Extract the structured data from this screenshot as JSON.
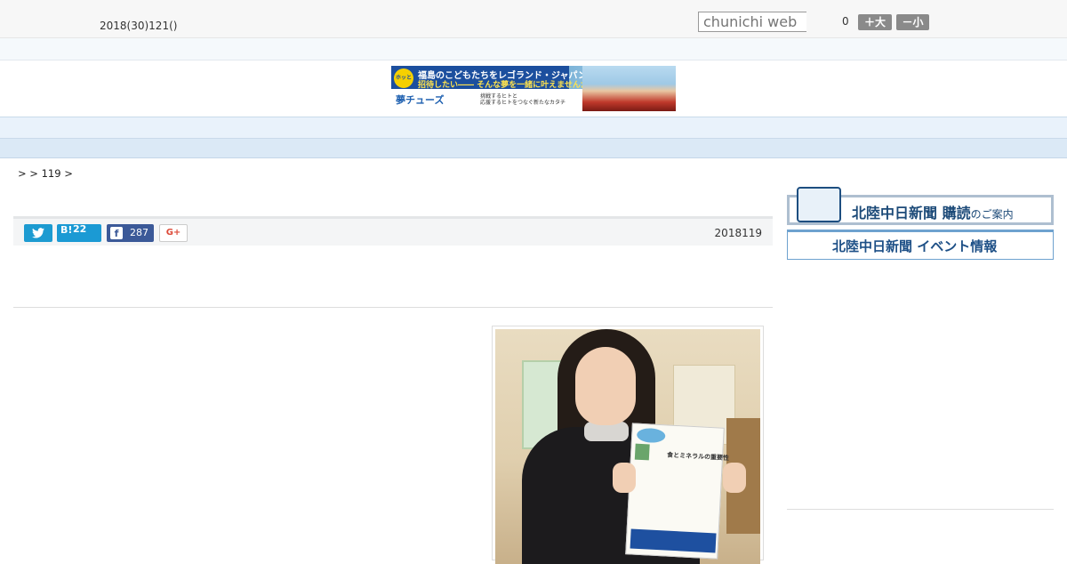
{
  "header": {
    "date": "2018(30)121()",
    "search_placeholder": "chunichi web",
    "count": "0",
    "font_larger": "＋大",
    "font_smaller": "－小"
  },
  "banner": {
    "badge": "ホッと石川",
    "line1": "福島のこどもたちをレゴランド・ジャパンに",
    "line2": "招待したい―― そんな夢を一緒に叶えませんか?",
    "brand": "夢チューズ",
    "subline1": "挑戦するヒトと",
    "subline2": "応援するヒトをつなぐ新たなカタチ"
  },
  "nav": {
    "items": [
      {
        "label": "　　"
      },
      {
        "label": "　　"
      },
      {
        "label": "　　"
      },
      {
        "label": "　　"
      },
      {
        "label": "　　"
      },
      {
        "label": "　　"
      },
      {
        "label": "　　"
      },
      {
        "label": "　　"
      },
      {
        "label": "　　"
      }
    ]
  },
  "breadcrumb": ">  > 119 >",
  "share": {
    "twitter_icon": "twitter-bird-icon",
    "hatena_label": "B!",
    "hatena_count": "22",
    "facebook_label": "f",
    "facebook_count": "287",
    "gplus_label": "G+"
  },
  "article": {
    "pubdate": "2018119"
  },
  "photo": {
    "flyer_title": "食とミネラルの重要性"
  },
  "sidebar": {
    "subscribe_label": "北陸中日新聞 購読",
    "subscribe_small": "のご案内",
    "event_label": "北陸中日新聞 イベント情報"
  },
  "colors": {
    "nav_bg": "#e9f2fb",
    "twitter": "#1d9bd1",
    "hatena": "#1b9ad4",
    "facebook": "#3b5998",
    "gplus": "#dd4b39"
  }
}
